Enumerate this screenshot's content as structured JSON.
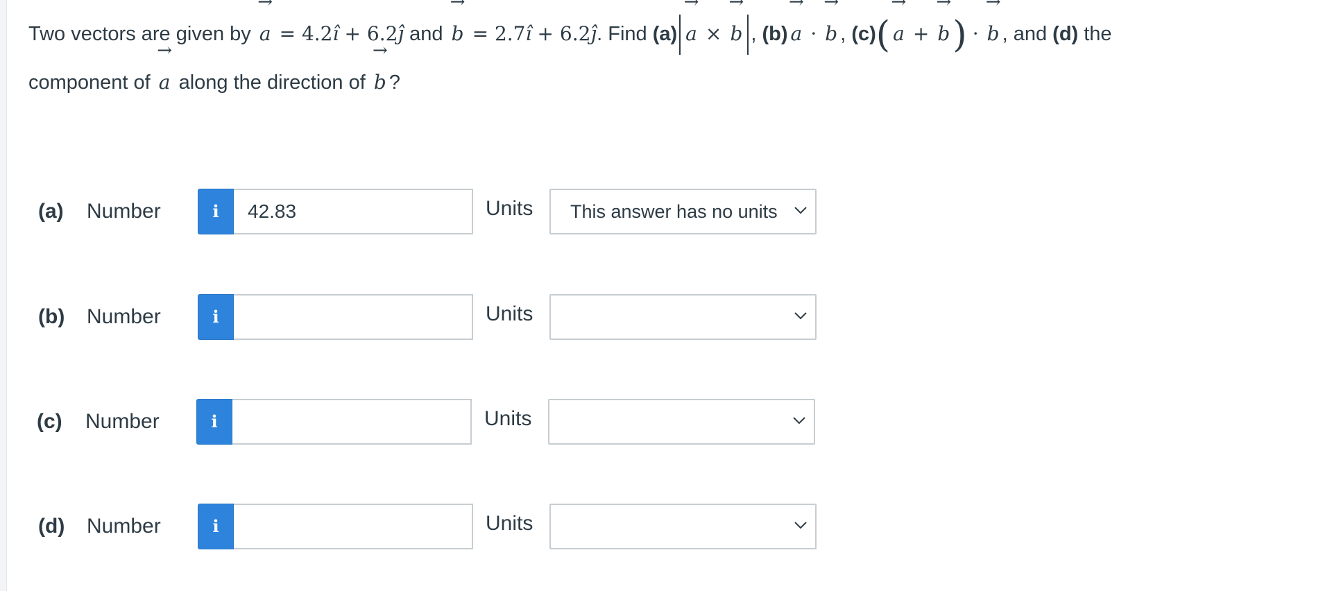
{
  "question": {
    "intro": "Two vectors are given by",
    "vec_a_sym": "a",
    "eq_a": "= 4.2",
    "i_hat": "î",
    "plus1": "+ 6.2",
    "j_hat": "ĵ",
    "and1": "and",
    "vec_b_sym": "b",
    "eq_b": "= 2.7",
    "plus2": "+ 6.2",
    "period_find": ". Find",
    "part_a": "(a)",
    "cross": "×",
    "comma_a": ",",
    "part_b": "(b)",
    "dot": "·",
    "comma_b": ",",
    "part_c": "(c)",
    "paren_open": "(",
    "plus3": "+",
    "paren_close": ")",
    "comma_and": ", and",
    "part_d": "(d)",
    "the": "the",
    "line2_text": "component of",
    "along": "along the direction of",
    "qmark": "?"
  },
  "rows": [
    {
      "label": "(a)",
      "number_label": "Number",
      "info_icon": "i",
      "value": "42.83",
      "placeholder": "",
      "units_label": "Units",
      "units_selected": "This answer has no units"
    },
    {
      "label": "(b)",
      "number_label": "Number",
      "info_icon": "i",
      "value": "",
      "placeholder": "",
      "units_label": "Units",
      "units_selected": ""
    },
    {
      "label": "(c)",
      "number_label": "Number",
      "info_icon": "i",
      "value": "",
      "placeholder": "",
      "units_label": "Units",
      "units_selected": ""
    },
    {
      "label": "(d)",
      "number_label": "Number",
      "info_icon": "i",
      "value": "",
      "placeholder": "",
      "units_label": "Units",
      "units_selected": ""
    }
  ],
  "colors": {
    "info_button": "#2e84dc",
    "text": "#2d3b45",
    "input_border": "#c7cdd1"
  },
  "icons": {
    "info": "info-icon",
    "select_arrow": "chevron-down-icon"
  }
}
